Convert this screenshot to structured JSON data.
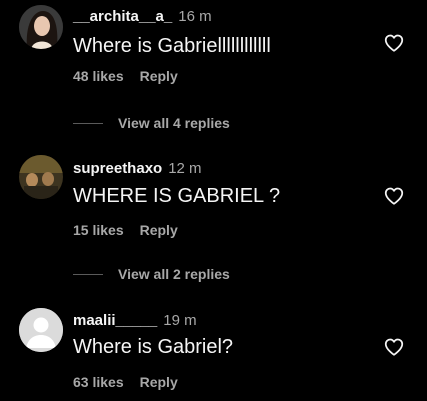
{
  "comments": [
    {
      "username": "__archita__a_",
      "time": "16 m",
      "text": "Where is Gabriellllllllllll",
      "likes": "48 likes",
      "reply": "Reply",
      "view_replies": "View all 4 replies",
      "avatar": "photo-avatar-woman"
    },
    {
      "username": "supreethaxo",
      "time": "12 m",
      "text": "WHERE IS GABRIEL ?",
      "likes": "15 likes",
      "reply": "Reply",
      "view_replies": "View all 2 replies",
      "avatar": "photo-avatar-group"
    },
    {
      "username": "maalii_____",
      "time": "19 m",
      "text": "Where is Gabriel?",
      "likes": "63 likes",
      "reply": "Reply",
      "avatar": "default-avatar"
    }
  ],
  "icons": {
    "like": "heart-outline-icon"
  },
  "colors": {
    "background": "#000000",
    "primary_text": "#f5f5f5",
    "secondary_text": "#a8a8a8"
  }
}
